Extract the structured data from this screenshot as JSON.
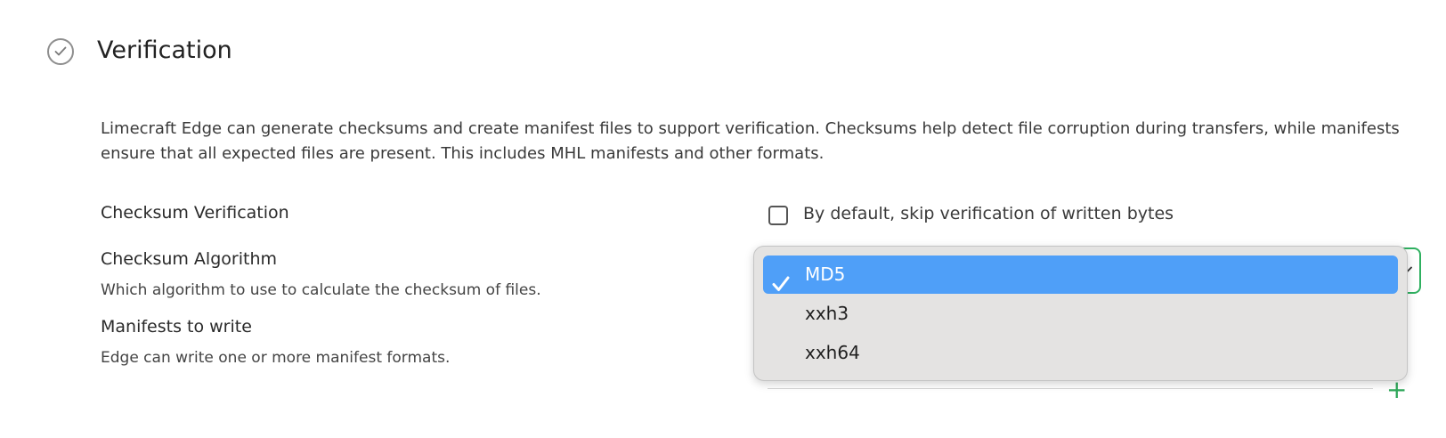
{
  "section": {
    "title": "Verification",
    "icon": "check-circle-icon",
    "description": "Limecraft Edge can generate checksums and create manifest files to support verification. Checksums help detect file corruption during transfers, while manifests ensure that all expected files are present. This includes MHL manifests and other formats."
  },
  "checksum_verification": {
    "label": "Checksum Verification",
    "checkbox_label": "By default, skip verification of written bytes",
    "checked": false
  },
  "checksum_algorithm": {
    "label": "Checksum Algorithm",
    "help": "Which algorithm to use to calculate the checksum of files.",
    "selected": "MD5",
    "options": [
      {
        "label": "MD5",
        "selected": true
      },
      {
        "label": "xxh3",
        "selected": false
      },
      {
        "label": "xxh64",
        "selected": false
      }
    ]
  },
  "manifests": {
    "label": "Manifests to write",
    "help": "Edge can write one or more manifest formats.",
    "add_icon": "plus-icon",
    "add_glyph": "+"
  },
  "colors": {
    "accent_green": "#2fb060",
    "selection_blue": "#4f9ff8",
    "popup_bg": "#e4e3e2"
  }
}
